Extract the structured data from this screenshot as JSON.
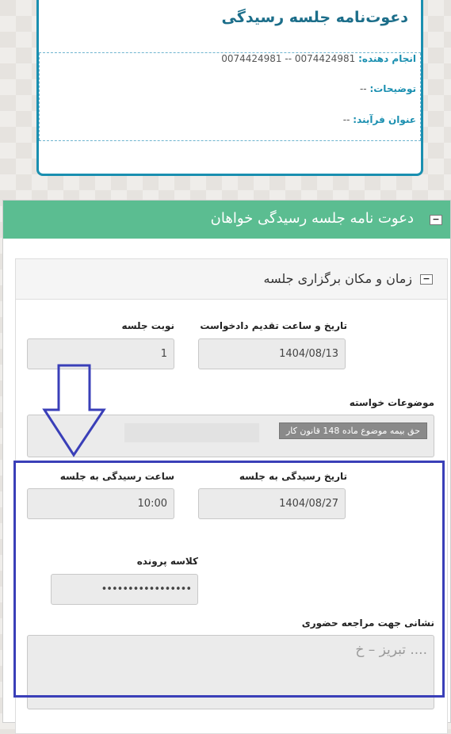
{
  "invite": {
    "title": "دعوت‌نامه جلسه رسیدگی",
    "performer_label": "انجام دهنده:",
    "performer_value": "0074424981 -- 0074424981",
    "description_label": "توضیحات:",
    "description_value": "--",
    "process_label": "عنوان فرآیند:",
    "process_value": "--"
  },
  "panel": {
    "title": "دعوت نامه جلسه رسیدگی خواهان",
    "collapse_symbol": "−",
    "section": {
      "title": "زمان و مکان برگزاری جلسه",
      "collapse_symbol": "−"
    }
  },
  "fields": {
    "submit_datetime_label": "تاریخ و ساعت تقدیم دادخواست",
    "submit_datetime_value": "1404/08/13",
    "session_turn_label": "نوبت جلسه",
    "session_turn_value": "1",
    "requested_topics_label": "موضوعات خواسته",
    "requested_topic_tag": "حق بیمه موضوع ماده 148 قانون کار",
    "hearing_date_label": "تاریخ رسیدگی به جلسه",
    "hearing_date_value": "1404/08/27",
    "hearing_time_label": "ساعت رسیدگی به جلسه",
    "hearing_time_value": "10:00",
    "case_class_label": "کلاسه پرونده",
    "case_class_value": "•••••••••••••••••",
    "address_label": "نشانی جهت مراجعه حضوری",
    "address_value": "تبریز – خ ...."
  },
  "colors": {
    "header_green": "#5bbd91",
    "card_border": "#1a8fb0",
    "annotation_blue": "#3a3fb8"
  }
}
